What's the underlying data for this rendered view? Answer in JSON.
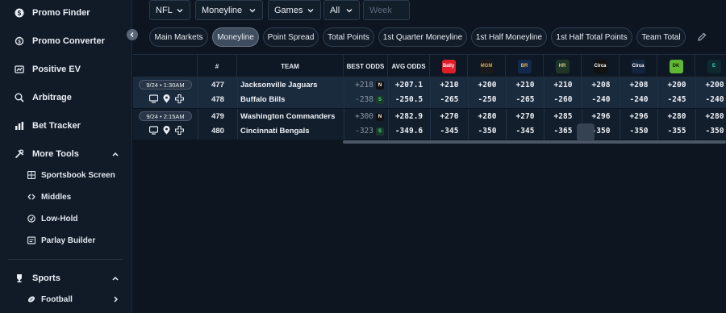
{
  "sidebar": {
    "items": [
      {
        "label": "Promo Finder",
        "icon": "dollar-circle-icon"
      },
      {
        "label": "Promo Converter",
        "icon": "convert-icon"
      },
      {
        "label": "Positive EV",
        "icon": "ev-icon"
      },
      {
        "label": "Arbitrage",
        "icon": "search-icon"
      },
      {
        "label": "Bet Tracker",
        "icon": "bar-chart-icon"
      },
      {
        "label": "More Tools",
        "icon": "tools-icon"
      }
    ],
    "tools": [
      {
        "label": "Sportsbook Screen",
        "icon": "grid-icon"
      },
      {
        "label": "Middles",
        "icon": "middles-icon"
      },
      {
        "label": "Low-Hold",
        "icon": "low-hold-icon"
      },
      {
        "label": "Parlay Builder",
        "icon": "parlay-icon"
      }
    ],
    "sports_label": "Sports",
    "football_label": "Football"
  },
  "filters": {
    "league": "NFL",
    "market": "Moneyline",
    "type": "Games",
    "scope": "All",
    "week_placeholder": "Week"
  },
  "markets": [
    "Main Markets",
    "Moneyline",
    "Point Spread",
    "Total Points",
    "1st Quarter Moneyline",
    "1st Half Moneyline",
    "1st Half Total Points",
    "Team Total"
  ],
  "active_market": "Moneyline",
  "table": {
    "headers": {
      "num": "#",
      "team": "TEAM",
      "best": "BEST ODDS",
      "avg": "AVG ODDS"
    },
    "books": [
      {
        "name": "ballybet",
        "short": "Bally",
        "bg": "#e11d2a",
        "fg": "#ffffff"
      },
      {
        "name": "betmgm",
        "short": "MGM",
        "bg": "#1a1a1a",
        "fg": "#c9a95a"
      },
      {
        "name": "betrivers",
        "short": "BR",
        "bg": "#13294b",
        "fg": "#e1b84a"
      },
      {
        "name": "hardrock",
        "short": "HR",
        "bg": "#1f3528",
        "fg": "#d7c48a"
      },
      {
        "name": "circa",
        "short": "Circa",
        "bg": "#111111",
        "fg": "#ffffff"
      },
      {
        "name": "circa-sports",
        "short": "Circa",
        "bg": "#16233d",
        "fg": "#ffffff"
      },
      {
        "name": "draftkings",
        "short": "DK",
        "bg": "#5fb734",
        "fg": "#0b1a06"
      },
      {
        "name": "espnbet",
        "short": "E",
        "bg": "#0e2a2e",
        "fg": "#36d1c4"
      }
    ],
    "games": [
      {
        "time": "9/24 • 1:30AM",
        "rows": [
          {
            "num": "477",
            "team": "Jacksonville Jaguars",
            "best": "+218",
            "best_book": "N",
            "best_book_bg": "#111111",
            "avg": "+207.1",
            "odds": [
              "+210",
              "+200",
              "+210",
              "+210",
              "+208",
              "+208",
              "+200",
              "+200"
            ]
          },
          {
            "num": "478",
            "team": "Buffalo Bills",
            "best": "-238",
            "best_book": "S",
            "best_book_bg": "#1a3a2a",
            "avg": "-250.5",
            "odds": [
              "-265",
              "-250",
              "-265",
              "-260",
              "-240",
              "-240",
              "-245",
              "-240"
            ]
          }
        ]
      },
      {
        "time": "9/24 • 2:15AM",
        "rows": [
          {
            "num": "479",
            "team": "Washington Commanders",
            "best": "+300",
            "best_book": "N",
            "best_book_bg": "#111111",
            "avg": "+282.9",
            "odds": [
              "+270",
              "+280",
              "+270",
              "+285",
              "+296",
              "+296",
              "+280",
              "+280"
            ]
          },
          {
            "num": "480",
            "team": "Cincinnati Bengals",
            "best": "-323",
            "best_book": "S",
            "best_book_bg": "#1a3a2a",
            "avg": "-349.6",
            "odds": [
              "-345",
              "-350",
              "-345",
              "-365",
              "-350",
              "-350",
              "-355",
              "-350"
            ]
          }
        ]
      }
    ]
  }
}
